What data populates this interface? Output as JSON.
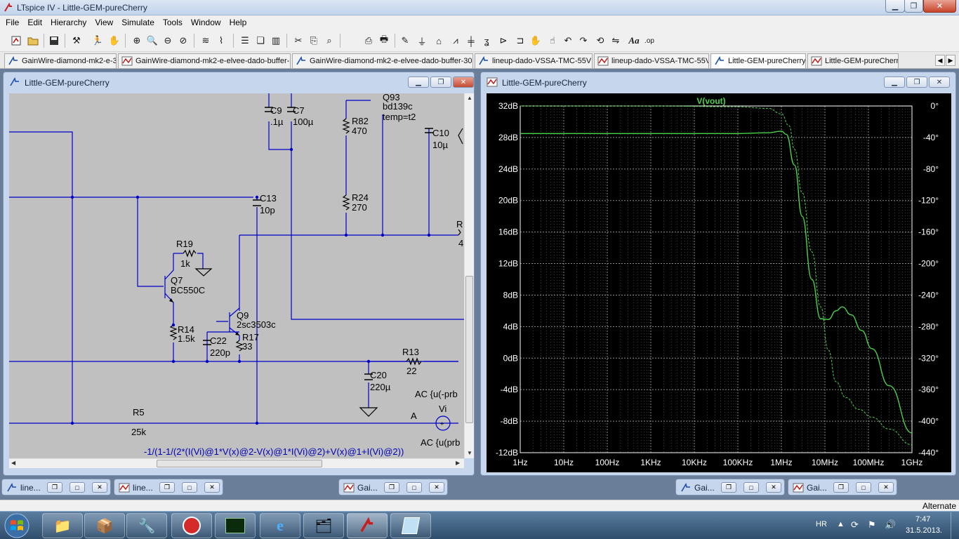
{
  "window": {
    "title": "LTspice IV - Little-GEM-pureCherry"
  },
  "menu": [
    "File",
    "Edit",
    "Hierarchy",
    "View",
    "Simulate",
    "Tools",
    "Window",
    "Help"
  ],
  "toolbar": [
    "new-schematic-icon",
    "open-icon",
    "save-icon",
    "control-panel-icon",
    "run-icon",
    "halt-icon",
    "zoom-in-icon",
    "zoom-area-icon",
    "zoom-out-icon",
    "zoom-cancel-icon",
    "autorange-icon",
    "plot-settings-icon",
    "tile-horizontal-icon",
    "cascade-icon",
    "tile-vertical-icon",
    "cut-icon",
    "copy-icon",
    "find-icon",
    "print-setup-icon",
    "print-icon",
    "draw-wire-icon",
    "ground-icon",
    "label-net-icon",
    "resistor-icon",
    "capacitor-icon",
    "inductor-icon",
    "diode-icon",
    "component-icon",
    "move-icon",
    "drag-icon",
    "undo-icon",
    "redo-icon",
    "rotate-icon",
    "mirror-icon",
    "text-icon",
    "spice-directive-icon"
  ],
  "tabs": [
    {
      "label": "GainWire-diamond-mk2-e-3",
      "icon": "schematic-icon"
    },
    {
      "label": "GainWire-diamond-mk2-e-elvee-dado-buffer-2",
      "icon": "waveform-icon"
    },
    {
      "label": "GainWire-diamond-mk2-e-elvee-dado-buffer-300",
      "icon": "schematic-icon"
    },
    {
      "label": "lineup-dado-VSSA-TMC-55V",
      "icon": "schematic-icon"
    },
    {
      "label": "lineup-dado-VSSA-TMC-55V",
      "icon": "waveform-icon"
    },
    {
      "label": "Little-GEM-pureCherry",
      "icon": "schematic-icon"
    },
    {
      "label": "Little-GEM-pureCherry",
      "icon": "waveform-icon"
    }
  ],
  "schematic": {
    "title": "Little-GEM-pureCherry",
    "labels": {
      "c9": "C9",
      "c9v": ".1µ",
      "c7": "C7",
      "c7v": "100µ",
      "q93": "Q93",
      "q93m": "bd139c",
      "q93t": "temp=t2",
      "r82": "R82",
      "r82v": "470",
      "c10": "C10",
      "c10v": "10µ",
      "c13": "C13",
      "c13v": "10p",
      "r24": "R24",
      "r24v": "270",
      "r19": "R19",
      "r19v": "1k",
      "q7": "Q7",
      "q7m": "BC550C",
      "q9": "Q9",
      "q9m": "2sc3503c",
      "r14": "R14",
      "r14v": "1.5k",
      "c22": "C22",
      "c22v": "220p",
      "r17": "R17",
      "r17v": "33",
      "r13": "R13",
      "r13v": "22",
      "c20": "C20",
      "c20v": "220µ",
      "r5": "R5",
      "r5v": "25k",
      "nodeA": "A",
      "vi": "Vi",
      "ac1": "AC {u(-prb",
      "ac2": "AC {u(prb",
      "rEdge": "R",
      "rEdgeV": "4",
      "formula": "-1/(1-1/(2*(I(Vi)@1*V(x)@2-V(x)@1*I(Vi)@2)+V(x)@1+I(Vi)@2))"
    }
  },
  "plot": {
    "title": "Little-GEM-pureCherry",
    "trace_label": "V(vout)",
    "trace_color": "#4ad24a"
  },
  "chart_data": {
    "type": "line",
    "title": "V(vout)",
    "xscale": "log",
    "xlim_hz": [
      1,
      1000000000
    ],
    "x_ticks": [
      "1Hz",
      "10Hz",
      "100Hz",
      "1KHz",
      "10KHz",
      "100KHz",
      "1MHz",
      "10MHz",
      "100MHz",
      "1GHz"
    ],
    "y_left_ticks": [
      "32dB",
      "28dB",
      "24dB",
      "20dB",
      "16dB",
      "12dB",
      "8dB",
      "4dB",
      "0dB",
      "-4dB",
      "-8dB",
      "-12dB"
    ],
    "y_left_lim_db": [
      -12,
      32
    ],
    "y_right_ticks": [
      "0°",
      "-40°",
      "-80°",
      "-120°",
      "-160°",
      "-200°",
      "-240°",
      "-280°",
      "-320°",
      "-360°",
      "-400°",
      "-440°"
    ],
    "y_right_lim_deg": [
      -440,
      0
    ],
    "grid": true,
    "series": [
      {
        "style": "solid",
        "x": [
          1,
          1000,
          100000,
          500000,
          1000000,
          1300000,
          2000000,
          3000000,
          5000000,
          8000000,
          12000000,
          18000000,
          25000000,
          40000000,
          70000000,
          120000000,
          300000000,
          1000000000
        ],
        "y": [
          28.5,
          28.5,
          28.5,
          28.6,
          28.8,
          28.4,
          24.5,
          18,
          10,
          5,
          4.9,
          6,
          6.5,
          5.5,
          3.5,
          1.2,
          -3.5,
          -9.5
        ]
      },
      {
        "style": "dashed",
        "x": [
          1,
          1000,
          100000,
          500000,
          1000000,
          1500000,
          2000000,
          3000000,
          5000000,
          8000000,
          12000000,
          18000000,
          30000000,
          60000000,
          120000000,
          300000000,
          1000000000
        ],
        "y": [
          0,
          0,
          -1,
          -3,
          -10,
          -25,
          -55,
          -110,
          -185,
          -255,
          -310,
          -350,
          -370,
          -385,
          -395,
          -410,
          -430
        ]
      }
    ]
  },
  "minimized": [
    {
      "label": "line...",
      "icon": "schematic-icon"
    },
    {
      "label": "line...",
      "icon": "waveform-icon"
    },
    {
      "label": "Gai...",
      "icon": "waveform-icon"
    },
    {
      "label": "Gai...",
      "icon": "schematic-icon"
    },
    {
      "label": "Gai...",
      "icon": "waveform-icon"
    }
  ],
  "status": {
    "text": "Alternate"
  },
  "taskbar": {
    "apps": [
      "explorer-folder-icon",
      "installer-icon",
      "wrench-icon",
      "red-app-icon",
      "oscilloscope-icon",
      "internet-explorer-icon",
      "documents-icon",
      "ltspice-icon",
      "notepad-icon"
    ],
    "lang": "HR",
    "time": "7:47",
    "date": "31.5.2013."
  }
}
